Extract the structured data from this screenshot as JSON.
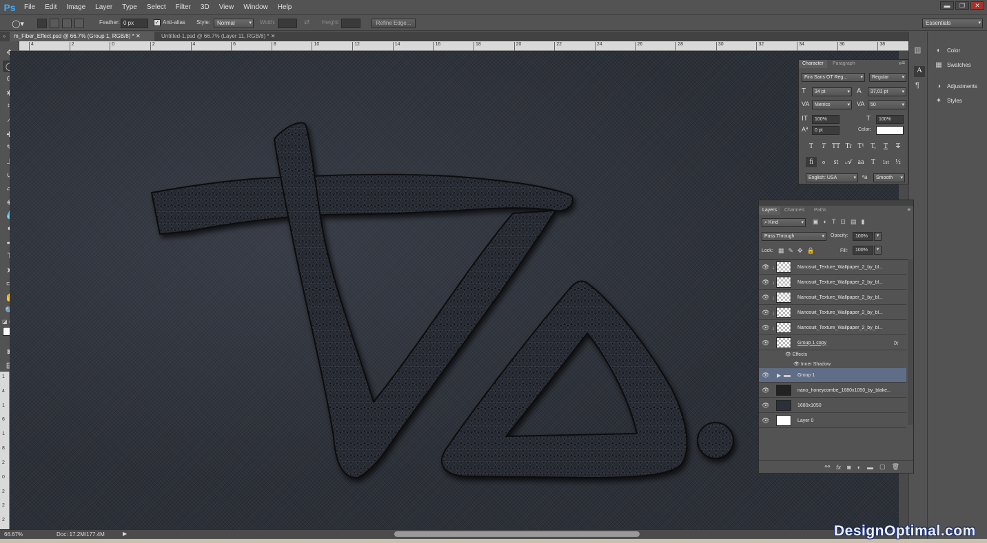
{
  "app": {
    "logo": "Ps"
  },
  "menu": [
    "File",
    "Edit",
    "Image",
    "Layer",
    "Type",
    "Select",
    "Filter",
    "3D",
    "View",
    "Window",
    "Help"
  ],
  "window_controls": [
    "▬",
    "❐",
    "✕"
  ],
  "options": {
    "feather_label": "Feather:",
    "feather_value": "0 px",
    "antialias_label": "Anti-alias",
    "style_label": "Style:",
    "style_value": "Normal",
    "width_label": "Width:",
    "height_label": "Height:",
    "refine_edge": "Refine Edge...",
    "workspace": "Essentials"
  },
  "tabs": [
    {
      "label": "m_Fiber_Effect.psd @ 66.7% (Group 1, RGB/8) *"
    },
    {
      "label": "Untitled-1.psd @ 66.7% (Layer 11, RGB/8) *"
    }
  ],
  "ruler_h_ticks": [
    "4",
    "2",
    "0",
    "2",
    "4",
    "6",
    "8",
    "10",
    "12",
    "14",
    "16",
    "18",
    "20",
    "22",
    "24",
    "26",
    "28",
    "30",
    "32",
    "34",
    "36",
    "38"
  ],
  "ruler_v_ticks": [
    "1",
    "4",
    "1",
    "6",
    "1",
    "8",
    "2",
    "0",
    "2",
    "2",
    "2"
  ],
  "status": {
    "zoom": "66.67%",
    "doc": "Doc: 17.2M/177.4M"
  },
  "dock": [
    {
      "icon": "palette-icon",
      "label": "Color"
    },
    {
      "icon": "swatches-icon",
      "label": "Swatches"
    },
    {
      "icon": "adjustments-icon",
      "label": "Adjustments"
    },
    {
      "icon": "styles-icon",
      "label": "Styles"
    }
  ],
  "character": {
    "tabs": [
      "Character",
      "Paragraph"
    ],
    "font_family": "Fira Sans OT Reg...",
    "font_style": "Regular",
    "size": "34 pt",
    "leading": "37,01 pt",
    "kerning": "Metrics",
    "tracking": "50",
    "vscale": "100%",
    "hscale": "100%",
    "baseline": "0 pt",
    "color_label": "Color:",
    "color_value": "#ffffff",
    "type_buttons": [
      "T",
      "T",
      "TT",
      "Tr",
      "T¹",
      "T,",
      "T",
      "T"
    ],
    "ot_buttons": [
      "ﬁ",
      "ℴ",
      "st",
      "𝒜",
      "aa",
      "T",
      "1st",
      "½"
    ],
    "language": "English: USA",
    "aa_label": "ªa",
    "antialias": "Smooth"
  },
  "layers": {
    "tabs": [
      "Layers",
      "Channels",
      "Paths"
    ],
    "filter": "Kind",
    "blend": "Pass Through",
    "opacity_label": "Opacity:",
    "opacity": "100%",
    "lock_label": "Lock:",
    "fill_label": "Fill:",
    "fill": "100%",
    "rows": [
      {
        "name": "Nanosuit_Texture_Wallpaper_2_by_bl..."
      },
      {
        "name": "Nanosuit_Texture_Wallpaper_2_by_bl..."
      },
      {
        "name": "Nanosuit_Texture_Wallpaper_2_by_bl..."
      },
      {
        "name": "Nanosuit_Texture_Wallpaper_2_by_bl..."
      },
      {
        "name": "Nanosuit_Texture_Wallpaper_2_by_bl..."
      },
      {
        "name": "Group 1 copy"
      },
      {
        "name": "Effects"
      },
      {
        "name": "Inner Shadow"
      },
      {
        "name": "Group 1"
      },
      {
        "name": "nano_honeycombe_1680x1050_by_blake..."
      },
      {
        "name": "1680x1050"
      },
      {
        "name": "Layer 0"
      }
    ],
    "fx_label": "fx",
    "footer_icons": [
      "link-icon",
      "fx-icon",
      "mask-icon",
      "adjustment-layer-icon",
      "folder-icon",
      "new-layer-icon",
      "trash-icon"
    ]
  },
  "watermark": "DesignOptimal.com",
  "colors": {
    "canvas_bg": "#2c3038",
    "layer_selected": "#5f6d86",
    "ps_blue": "#3fa9f5"
  }
}
